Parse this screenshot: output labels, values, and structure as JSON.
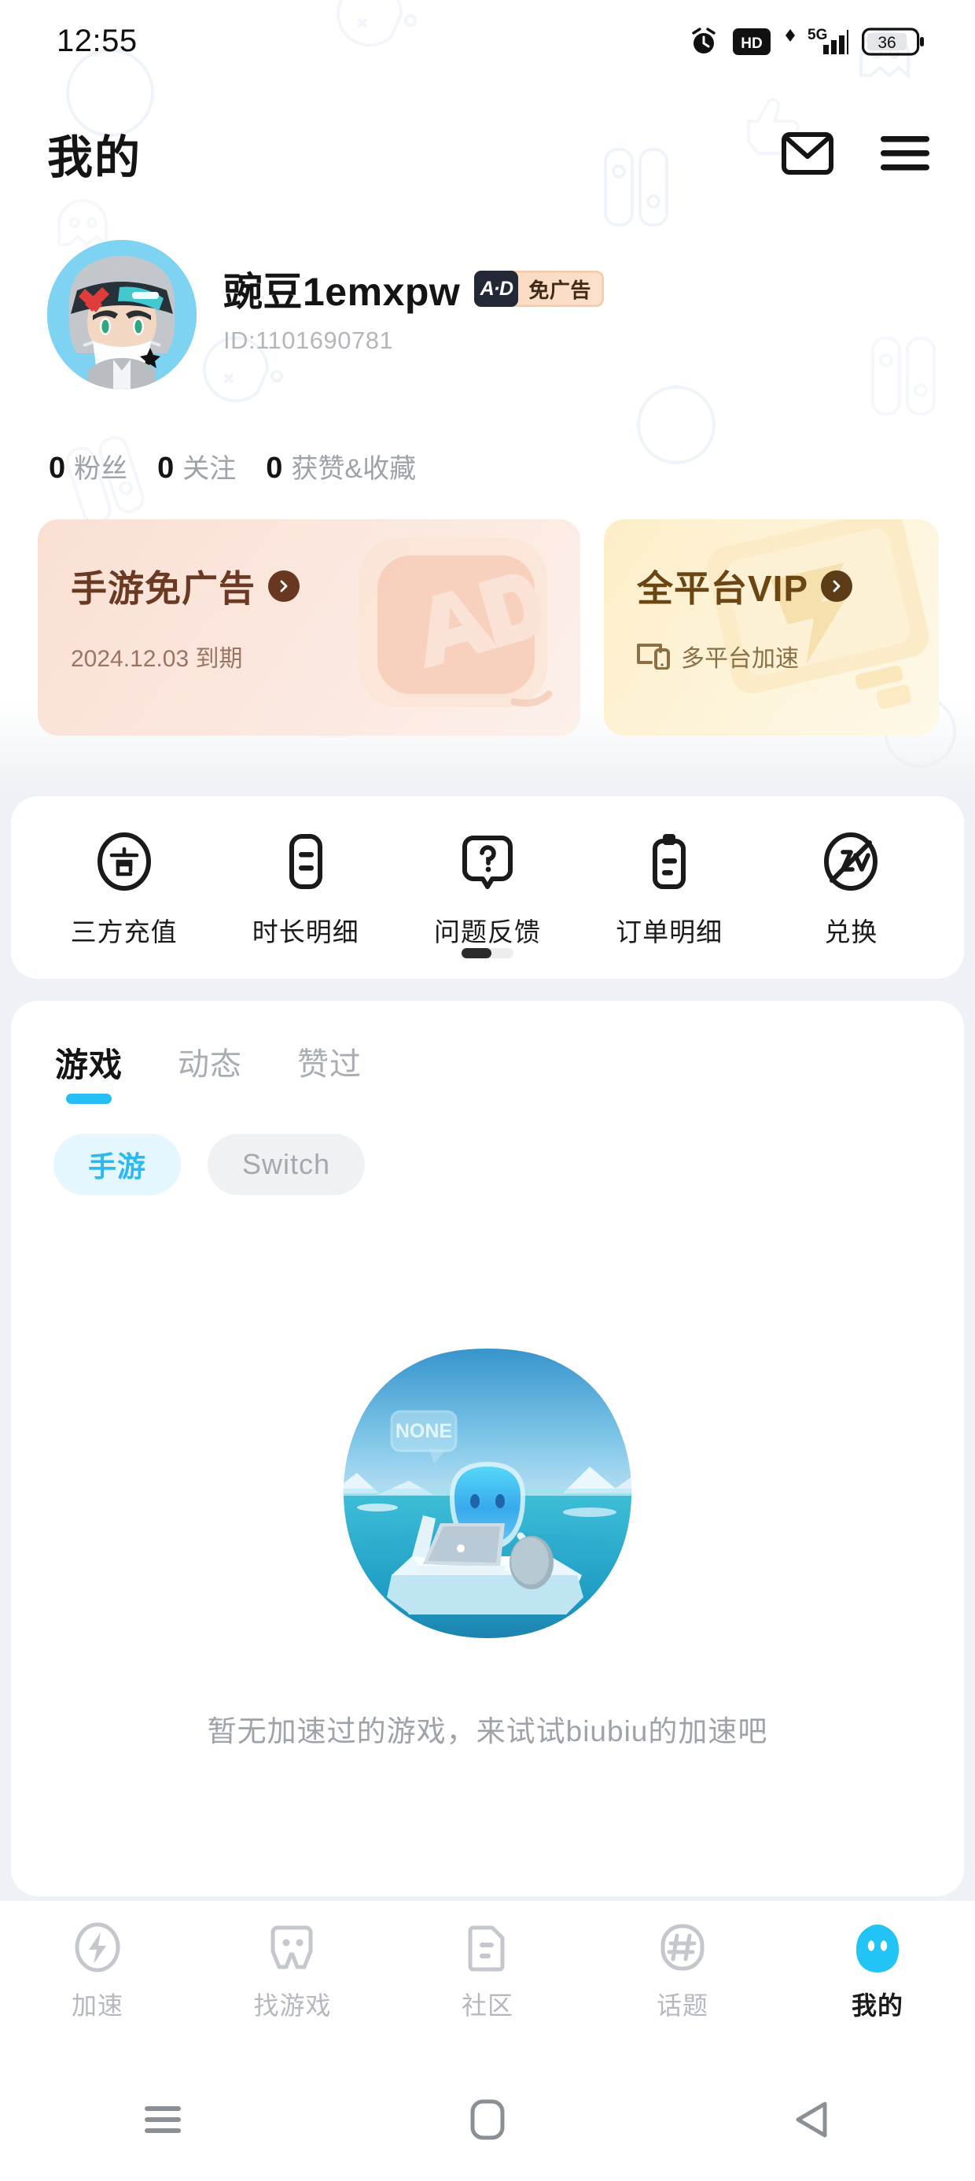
{
  "status_bar": {
    "time": "12:55",
    "icons": [
      "alarm-icon",
      "hd-icon",
      "5g-signal-icon",
      "battery-icon"
    ],
    "network_label": "5G",
    "hd_label": "HD",
    "battery_level": "36"
  },
  "header": {
    "title": "我的",
    "mail_icon": "mail-icon",
    "menu_icon": "hamburger-menu-icon"
  },
  "profile": {
    "username": "豌豆1emxpw",
    "user_id": "ID:1101690781",
    "badge": {
      "chip": "A·D",
      "label": "免广告"
    },
    "avatar_alt": "avatar"
  },
  "stats": [
    {
      "count": "0",
      "label": "粉丝"
    },
    {
      "count": "0",
      "label": "关注"
    },
    {
      "count": "0",
      "label": "获赞&收藏"
    }
  ],
  "promos": [
    {
      "title": "手游免广告",
      "subtitle": "2024.12.03 到期",
      "accent": "#6b3a22",
      "bg_start": "#fae0d4",
      "bg_end": "#fcf0ea"
    },
    {
      "title": "全平台VIP",
      "subtitle": "多平台加速",
      "accent": "#6b4512",
      "bg_start": "#fdeec8",
      "bg_end": "#fdf8e8"
    }
  ],
  "quick_actions": [
    {
      "label": "三方充值",
      "icon": "recharge-circle-icon"
    },
    {
      "label": "时长明细",
      "icon": "duration-list-icon"
    },
    {
      "label": "问题反馈",
      "icon": "question-bubble-icon"
    },
    {
      "label": "订单明细",
      "icon": "order-clipboard-icon"
    },
    {
      "label": "兑换",
      "icon": "redeem-icon"
    }
  ],
  "tabs": [
    {
      "label": "游戏",
      "active": true
    },
    {
      "label": "动态",
      "active": false
    },
    {
      "label": "赞过",
      "active": false
    }
  ],
  "chips": [
    {
      "label": "手游",
      "active": true
    },
    {
      "label": "Switch",
      "active": false
    }
  ],
  "empty_state": {
    "text": "暂无加速过的游戏，来试试biubiu的加速吧",
    "illustration": "iceberg-mascot-illustration",
    "bubble_text": "NONE"
  },
  "bottom_nav": [
    {
      "label": "加速",
      "icon": "bolt-icon",
      "active": false
    },
    {
      "label": "找游戏",
      "icon": "gamepad-icon",
      "active": false
    },
    {
      "label": "社区",
      "icon": "community-doc-icon",
      "active": false
    },
    {
      "label": "话题",
      "icon": "hash-topic-icon",
      "active": false
    },
    {
      "label": "我的",
      "icon": "mascot-profile-icon",
      "active": true
    }
  ],
  "system_nav": [
    {
      "icon": "recent-apps-icon"
    },
    {
      "icon": "home-icon"
    },
    {
      "icon": "back-icon"
    }
  ],
  "colors": {
    "accent_blue": "#27bdf5",
    "page_bg": "#eef1f5",
    "card_bg": "#ffffff",
    "muted_text": "#9ea3aa"
  }
}
